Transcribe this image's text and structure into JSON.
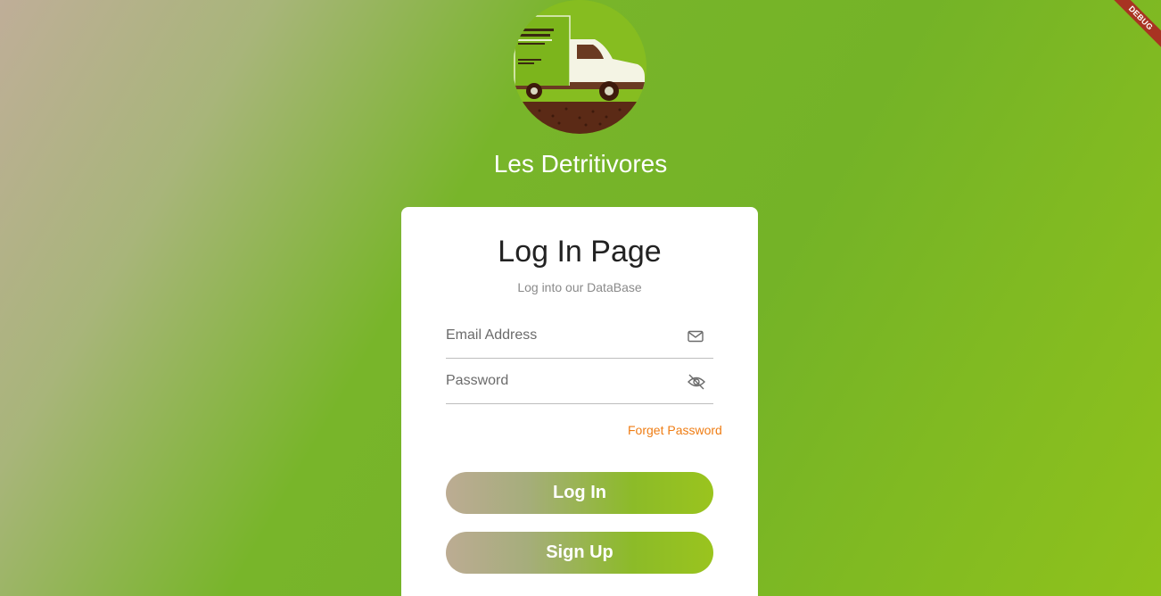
{
  "debug_banner": {
    "label": "DEBUG",
    "color": "#a83322"
  },
  "app": {
    "title": "Les Detritivores",
    "logo_icon": "delivery-truck-logo"
  },
  "card": {
    "title": "Log In Page",
    "subtitle": "Log into our DataBase"
  },
  "form": {
    "email": {
      "placeholder": "Email Address",
      "value": "",
      "icon": "mail-icon"
    },
    "password": {
      "placeholder": "Password",
      "value": "",
      "icon": "eye-slash-icon"
    },
    "forgot_label": "Forget Password"
  },
  "buttons": {
    "login_label": "Log In",
    "signup_label": "Sign Up"
  },
  "colors": {
    "accent_orange": "#ef7d14",
    "brand_green": "#78b52a",
    "button_start": "#bcac93",
    "button_end": "#9ac41e"
  }
}
